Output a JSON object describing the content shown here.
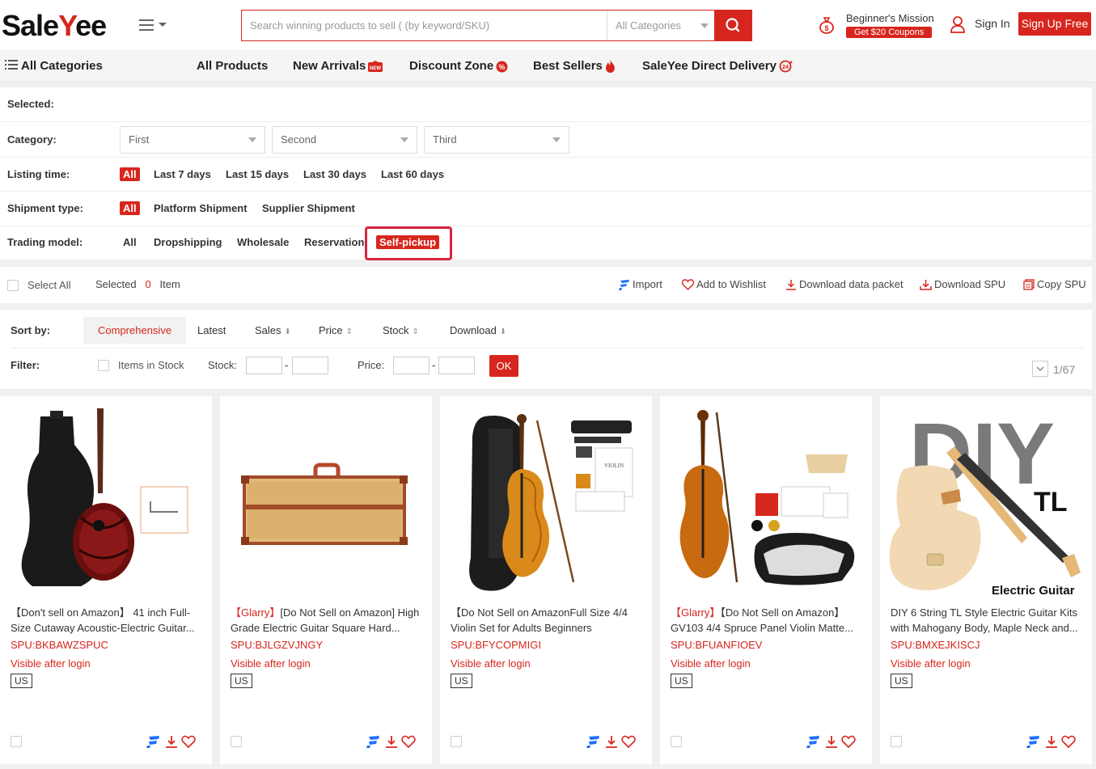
{
  "header": {
    "logo_prefix": "Sale",
    "logo_y": "Y",
    "logo_suffix": "ee",
    "search_placeholder": "Search winning products to sell ( (by keyword/SKU)",
    "category_select": "All Categories",
    "mission_label": "Beginner's Mission",
    "coupon_label": "Get $20 Coupons",
    "signin_label": "Sign In",
    "signup_label": "Sign Up Free"
  },
  "nav": {
    "all_categories": "All Categories",
    "items": [
      "All Products",
      "New Arrivals",
      "Discount Zone",
      "Best Sellers",
      "SaleYee Direct Delivery"
    ],
    "new_badge": "NEW",
    "delivery_badge": "24"
  },
  "filters": {
    "selected_label": "Selected:",
    "category_label": "Category:",
    "category_dropdowns": [
      "First",
      "Second",
      "Third"
    ],
    "listing_label": "Listing time:",
    "listing_options": [
      "All",
      "Last 7 days",
      "Last 15 days",
      "Last 30 days",
      "Last 60 days"
    ],
    "shipment_label": "Shipment type:",
    "shipment_options": [
      "All",
      "Platform Shipment",
      "Supplier Shipment"
    ],
    "trading_label": "Trading model:",
    "trading_options": [
      "All",
      "Dropshipping",
      "Wholesale",
      "Reservation",
      "Self-pickup"
    ]
  },
  "actions": {
    "select_all": "Select All",
    "selected_prefix": "Selected",
    "selected_count": "0",
    "selected_suffix": "Item",
    "import": "Import",
    "wishlist": "Add to Wishlist",
    "download_packet": "Download data packet",
    "download_spu": "Download SPU",
    "copy_spu": "Copy SPU"
  },
  "sort": {
    "label": "Sort by:",
    "options": [
      "Comprehensive",
      "Latest",
      "Sales",
      "Price",
      "Stock",
      "Download"
    ],
    "filter_label": "Filter:",
    "in_stock": "Items in Stock",
    "stock_label": "Stock:",
    "price_label": "Price:",
    "dash": "-",
    "ok": "OK",
    "page_indicator": "1/67"
  },
  "products": [
    {
      "brand": "",
      "title": "【Don't sell on Amazon】 41 inch Full-Size Cutaway Acoustic-Electric Guitar...",
      "spu": "SPU:BKBAWZSPUC",
      "visibility": "Visible after login",
      "country": "US"
    },
    {
      "brand": "【Glarry】",
      "title": "[Do Not Sell on Amazon] High Grade Electric Guitar Square Hard...",
      "spu": "SPU:BJLGZVJNGY",
      "visibility": "Visible after login",
      "country": "US"
    },
    {
      "brand": "",
      "title": "【Do Not Sell on AmazonFull Size 4/4 Violin Set for Adults Beginners Students...",
      "spu": "SPU:BFYCOPMIGI",
      "visibility": "Visible after login",
      "country": "US"
    },
    {
      "brand": "【Glarry】",
      "title": "【Do Not Sell on Amazon】 GV103 4/4 Spruce Panel Violin Matte...",
      "spu": "SPU:BFUANFIOEV",
      "visibility": "Visible after login",
      "country": "US"
    },
    {
      "brand": "",
      "title": "DIY 6 String TL Style Electric Guitar Kits with Mahogany Body, Maple Neck and...",
      "spu": "SPU:BMXEJKISCJ",
      "visibility": "Visible after login",
      "country": "US"
    }
  ],
  "product5_image_text": {
    "big": "DIY",
    "sub": "TL",
    "caption": "Electric Guitar"
  },
  "violin_label": "VIOLIN",
  "colors": {
    "accent": "#d7261e",
    "highlight_border": "#d7263e",
    "import_blue": "#1e6fff"
  }
}
